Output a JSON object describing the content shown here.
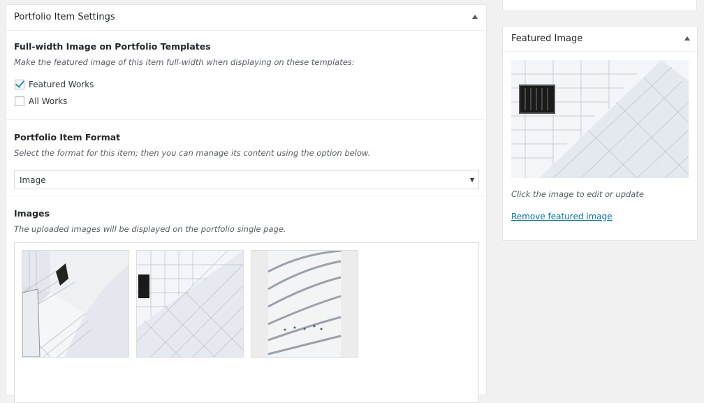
{
  "portfolio_settings": {
    "title": "Portfolio Item Settings",
    "fullwidth": {
      "title": "Full-width Image on Portfolio Templates",
      "description": "Make the featured image of this item full-width when displaying on these templates:",
      "options": [
        {
          "label": "Featured Works",
          "checked": true
        },
        {
          "label": "All Works",
          "checked": false
        }
      ]
    },
    "format": {
      "title": "Portfolio Item Format",
      "description": "Select the format for this item; then you can manage its content using the option below.",
      "selected": "Image"
    },
    "images": {
      "title": "Images",
      "description": "The uploaded images will be displayed on the portfolio single page."
    }
  },
  "featured_image": {
    "title": "Featured Image",
    "hint": "Click the image to edit or update",
    "remove_link": "Remove featured image"
  },
  "colors": {
    "link": "#0073aa",
    "checkmark": "#1e8cbe",
    "panel_bg": "#ffffff",
    "page_bg": "#f1f1f1"
  }
}
